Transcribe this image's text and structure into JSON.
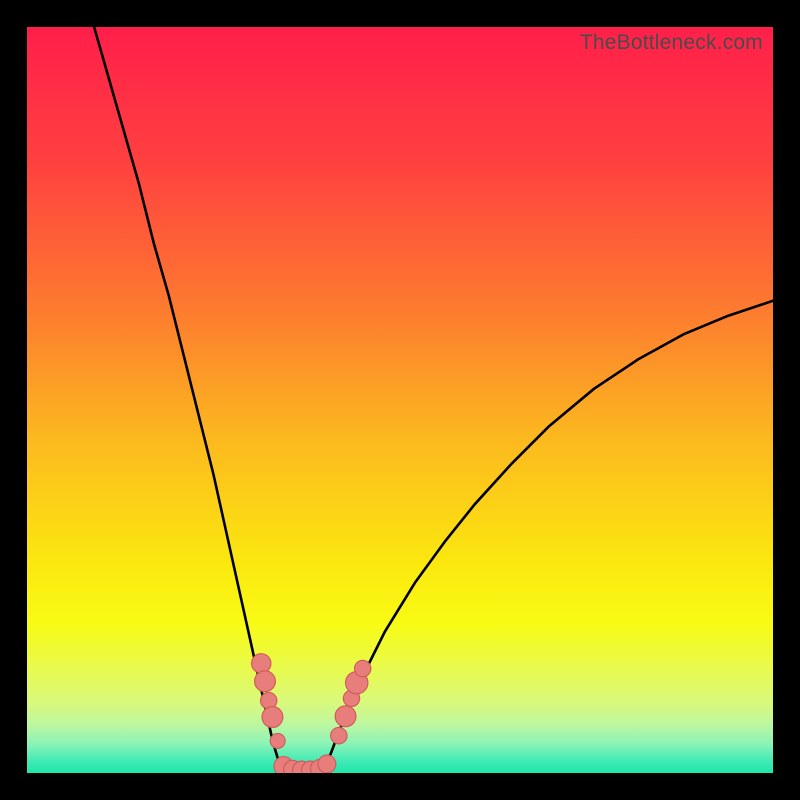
{
  "watermark": "TheBottleneck.com",
  "colors": {
    "black": "#000000",
    "curve_stroke": "#000000",
    "marker_fill": "#e77e7b",
    "marker_stroke": "#cf5a57",
    "gradient_stops": [
      {
        "offset": 0.0,
        "color": "#ff1f4a"
      },
      {
        "offset": 0.18,
        "color": "#ff4040"
      },
      {
        "offset": 0.38,
        "color": "#fd7b2f"
      },
      {
        "offset": 0.55,
        "color": "#fcb81f"
      },
      {
        "offset": 0.72,
        "color": "#fbe80f"
      },
      {
        "offset": 0.8,
        "color": "#f8fb14"
      },
      {
        "offset": 0.86,
        "color": "#e8fa4e"
      },
      {
        "offset": 0.905,
        "color": "#d9f97b"
      },
      {
        "offset": 0.935,
        "color": "#bdf7a0"
      },
      {
        "offset": 0.96,
        "color": "#8df3b6"
      },
      {
        "offset": 0.985,
        "color": "#3eeab5"
      },
      {
        "offset": 1.0,
        "color": "#1ee6a9"
      }
    ]
  },
  "chart_data": {
    "type": "line",
    "title": "",
    "xlabel": "",
    "ylabel": "",
    "x_range": [
      0,
      100
    ],
    "y_range": [
      0,
      100
    ],
    "note": "Two curve branches descending into a narrow valley near x≈34–40. Left branch starts at top-left (x≈9, y≈100) and dives to valley floor (y≈0) around x≈34. Right branch rises from valley around x≈40 to upper-right edge at roughly (x≈100, y≈63). Values are percent of plot height (0 at bottom, 100 at top).",
    "left_branch": [
      {
        "x": 9.0,
        "y": 100.0
      },
      {
        "x": 11.0,
        "y": 93.0
      },
      {
        "x": 13.0,
        "y": 86.0
      },
      {
        "x": 15.0,
        "y": 79.0
      },
      {
        "x": 17.0,
        "y": 71.0
      },
      {
        "x": 19.0,
        "y": 64.0
      },
      {
        "x": 21.0,
        "y": 56.0
      },
      {
        "x": 23.0,
        "y": 48.0
      },
      {
        "x": 25.0,
        "y": 40.0
      },
      {
        "x": 27.0,
        "y": 31.0
      },
      {
        "x": 29.0,
        "y": 22.0
      },
      {
        "x": 31.0,
        "y": 13.0
      },
      {
        "x": 33.0,
        "y": 4.0
      },
      {
        "x": 34.0,
        "y": 0.7
      }
    ],
    "valley_floor": [
      {
        "x": 34.0,
        "y": 0.7
      },
      {
        "x": 35.5,
        "y": 0.3
      },
      {
        "x": 37.0,
        "y": 0.3
      },
      {
        "x": 38.5,
        "y": 0.3
      },
      {
        "x": 40.0,
        "y": 0.7
      }
    ],
    "right_branch": [
      {
        "x": 40.0,
        "y": 0.7
      },
      {
        "x": 42.0,
        "y": 6.0
      },
      {
        "x": 45.0,
        "y": 13.0
      },
      {
        "x": 48.0,
        "y": 19.0
      },
      {
        "x": 52.0,
        "y": 25.5
      },
      {
        "x": 56.0,
        "y": 31.0
      },
      {
        "x": 60.0,
        "y": 36.0
      },
      {
        "x": 65.0,
        "y": 41.5
      },
      {
        "x": 70.0,
        "y": 46.5
      },
      {
        "x": 76.0,
        "y": 51.5
      },
      {
        "x": 82.0,
        "y": 55.5
      },
      {
        "x": 88.0,
        "y": 58.8
      },
      {
        "x": 94.0,
        "y": 61.3
      },
      {
        "x": 100.0,
        "y": 63.3
      }
    ],
    "markers": {
      "description": "Salmon-colored dot clusters near the valley on both branches and along the floor.",
      "points": [
        {
          "x": 31.4,
          "y": 14.7,
          "r": 1.3
        },
        {
          "x": 31.9,
          "y": 12.3,
          "r": 1.4
        },
        {
          "x": 32.4,
          "y": 9.7,
          "r": 1.1
        },
        {
          "x": 32.9,
          "y": 7.5,
          "r": 1.4
        },
        {
          "x": 33.6,
          "y": 4.3,
          "r": 1.0
        },
        {
          "x": 34.4,
          "y": 0.9,
          "r": 1.3
        },
        {
          "x": 35.6,
          "y": 0.5,
          "r": 1.2
        },
        {
          "x": 36.8,
          "y": 0.4,
          "r": 1.2
        },
        {
          "x": 38.0,
          "y": 0.4,
          "r": 1.2
        },
        {
          "x": 39.2,
          "y": 0.6,
          "r": 1.2
        },
        {
          "x": 40.2,
          "y": 1.2,
          "r": 1.2
        },
        {
          "x": 41.8,
          "y": 5.0,
          "r": 1.1
        },
        {
          "x": 42.7,
          "y": 7.6,
          "r": 1.4
        },
        {
          "x": 43.5,
          "y": 10.0,
          "r": 1.1
        },
        {
          "x": 44.2,
          "y": 12.1,
          "r": 1.5
        },
        {
          "x": 45.0,
          "y": 14.0,
          "r": 1.1
        }
      ]
    }
  }
}
